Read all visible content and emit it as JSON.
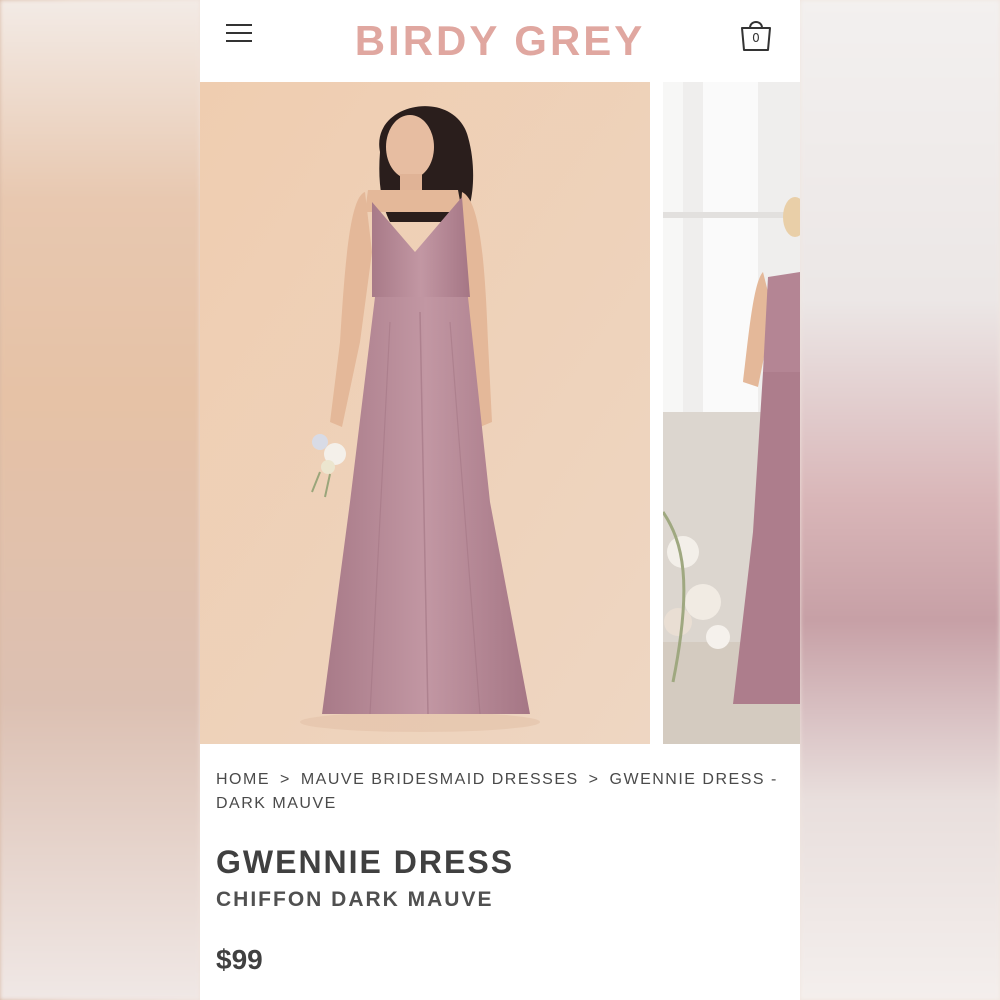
{
  "header": {
    "logo": "BIRDY GREY",
    "cart_count": "0",
    "menu_icon": "hamburger-menu-icon",
    "cart_icon": "shopping-bag-icon"
  },
  "gallery": {
    "images": [
      {
        "alt": "Model wearing Gwennie Dress in Dark Mauve holding a bouquet"
      },
      {
        "alt": "Gwennie Dress in Dark Mauve side view"
      }
    ]
  },
  "breadcrumb": {
    "items": [
      "HOME",
      "MAUVE BRIDESMAID DRESSES",
      "GWENNIE DRESS - DARK MAUVE"
    ],
    "separator": ">"
  },
  "product": {
    "name": "GWENNIE DRESS",
    "variant": "CHIFFON DARK MAUVE",
    "price": "$99"
  },
  "colors": {
    "brand": "#e0a7a0",
    "dress": "#b88795",
    "backdrop": "#ecc9ad"
  }
}
